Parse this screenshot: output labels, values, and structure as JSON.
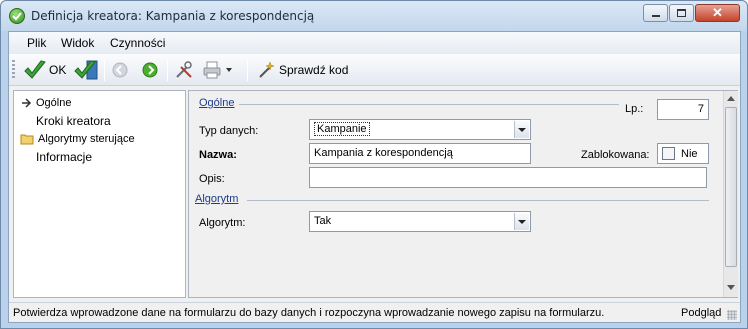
{
  "window": {
    "title": "Definicja kreatora: Kampania z korespondencją"
  },
  "menu": {
    "items": [
      {
        "label": "Plik"
      },
      {
        "label": "Widok"
      },
      {
        "label": "Czynności"
      }
    ]
  },
  "toolbar": {
    "ok_label": "OK",
    "check_label": "Sprawdź kod"
  },
  "tree": {
    "items": [
      {
        "label": "Ogólne",
        "icon": "arrow-right-icon"
      },
      {
        "label": "Kroki kreatora",
        "icon": ""
      },
      {
        "label": "Algorytmy sterujące",
        "icon": "folder-icon"
      },
      {
        "label": "Informacje",
        "icon": ""
      }
    ]
  },
  "form": {
    "general_section": "Ogólne",
    "lp_label": "Lp.:",
    "lp_value": "7",
    "type_label": "Typ danych:",
    "type_value": "Kampanie",
    "name_label": "Nazwa:",
    "name_value": "Kampania z korespondencją",
    "locked_label": "Zablokowana:",
    "locked_value": "Nie",
    "description_label": "Opis:",
    "description_value": "",
    "algorithm_section": "Algorytm",
    "algorithm_label": "Algorytm:",
    "algorithm_value": "Tak"
  },
  "status": {
    "message": "Potwierdza wprowadzone dane na formularzu do bazy danych i rozpoczyna wprowadzanie nowego zapisu na formularzu.",
    "mode": "Podgląd"
  },
  "colors": {
    "accent_check": "#3da23a",
    "section_label": "#1f3c8a"
  }
}
